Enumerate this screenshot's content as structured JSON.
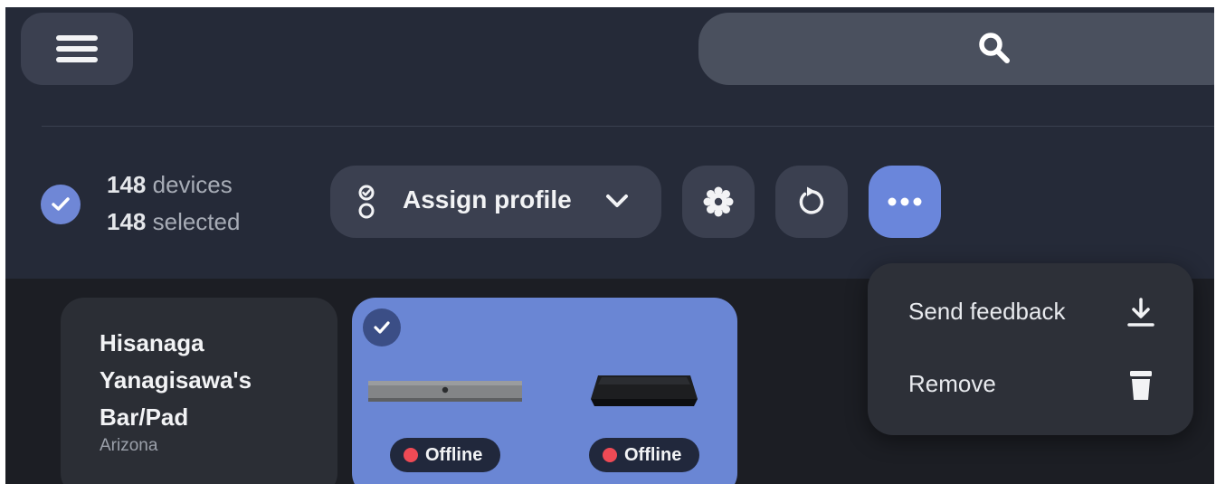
{
  "toolbar": {
    "menu_icon": "hamburger-icon",
    "search_icon": "search-icon"
  },
  "selection": {
    "devices_count": "148",
    "devices_label": " devices",
    "selected_count": "148",
    "selected_label": " selected"
  },
  "actions": {
    "assign_profile_label": "Assign profile",
    "assign_profile_icon": "profile-toggle-icon",
    "settings_icon": "gear-icon",
    "restart_icon": "restart-icon",
    "more_icon": "more-icon"
  },
  "devices": [
    {
      "name": "Hisanaga Yanagisawa's Bar/Pad",
      "location": "Arizona"
    }
  ],
  "selected_device": {
    "statuses": [
      "Offline",
      "Offline"
    ]
  },
  "more_menu": {
    "items": [
      {
        "label": "Send feedback",
        "icon": "download-icon"
      },
      {
        "label": "Remove",
        "icon": "trash-icon"
      }
    ]
  },
  "colors": {
    "accent": "#6a86db",
    "status_offline": "#ef4a55",
    "header_bg": "#252a38",
    "content_bg": "#1c1e24"
  }
}
